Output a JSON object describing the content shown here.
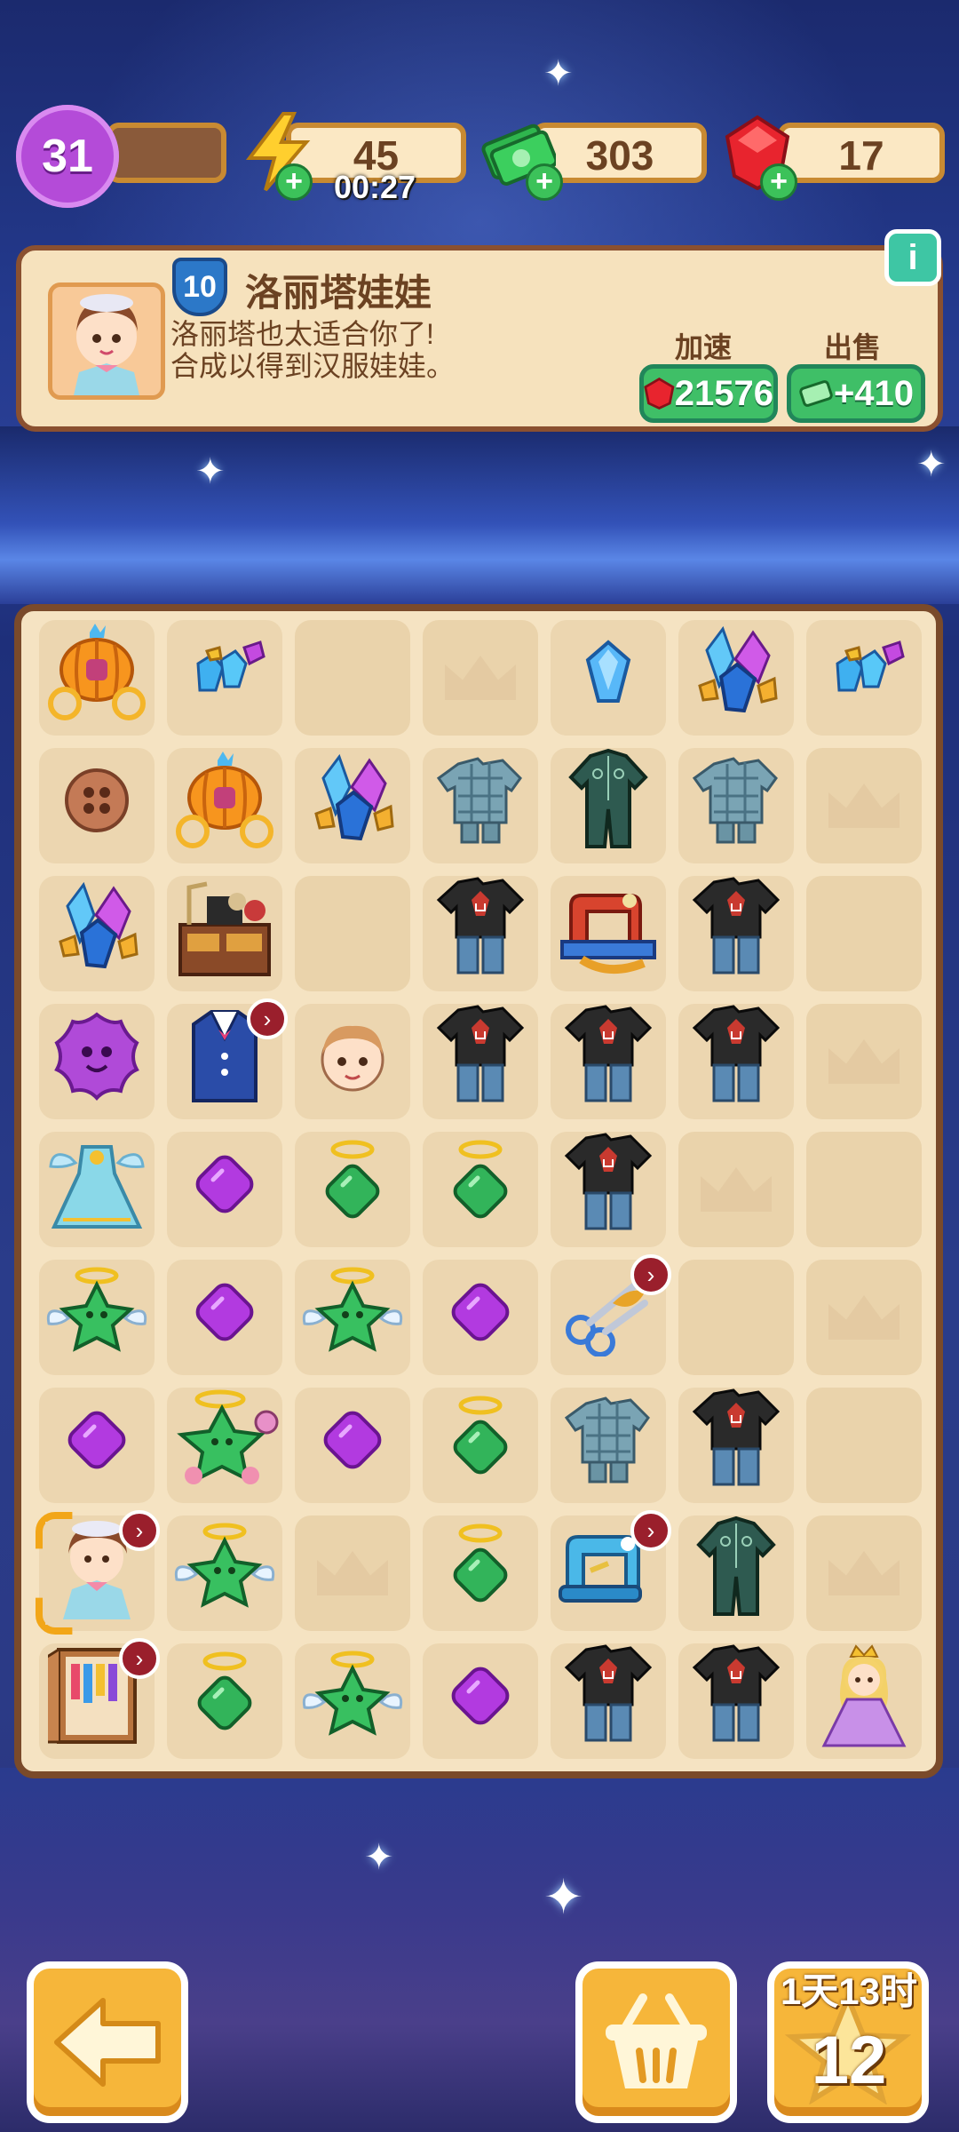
{
  "status": {
    "level": "31",
    "energy": "45",
    "energy_timer": "00:27",
    "cash": "303",
    "gems": "17"
  },
  "info_card": {
    "item_level": "10",
    "item_name": "洛丽塔娃娃",
    "desc_line1": "洛丽塔也太适合你了!",
    "desc_line2": "合成以得到汉服娃娃。",
    "speedup_label": "加速",
    "speedup_cost": "21576",
    "sell_label": "出售",
    "sell_value": "+410"
  },
  "bag": {
    "timer": "1天13时",
    "count": "12"
  },
  "board": {
    "rows": [
      [
        "pumpkin-carriage",
        "gem-cluster-small",
        "empty",
        "crown-empty",
        "crystal-small",
        "gem-cluster-large",
        "gem-cluster-small"
      ],
      [
        "button",
        "pumpkin-carriage",
        "gem-cluster-large",
        "plaid-outfit",
        "green-tracksuit",
        "plaid-outfit",
        "crown-empty"
      ],
      [
        "gem-cluster-large",
        "sewing-workbench",
        "empty",
        "rock-tshirt-outfit",
        "sewing-machine-red",
        "rock-tshirt-outfit",
        "empty"
      ],
      [
        "purple-flower",
        "vest-outfit",
        "doll-head",
        "rock-tshirt-outfit",
        "rock-tshirt-outfit",
        "rock-tshirt-outfit",
        "crown-empty"
      ],
      [
        "fairy-dress",
        "purple-diamond",
        "green-halo-gem",
        "green-halo-gem",
        "rock-tshirt-outfit",
        "crown-empty",
        "empty"
      ],
      [
        "green-angel-star",
        "purple-diamond",
        "green-angel-star",
        "purple-diamond",
        "scissors",
        "empty",
        "crown-empty"
      ],
      [
        "purple-diamond",
        "green-angel-star-big",
        "purple-diamond",
        "green-halo-gem",
        "plaid-outfit",
        "rock-tshirt-outfit",
        "empty"
      ],
      [
        "lolita-doll",
        "green-angel-star",
        "crown-empty",
        "green-halo-gem",
        "sewing-machine-blue",
        "green-tracksuit",
        "crown-empty"
      ],
      [
        "wardrobe",
        "green-halo-gem",
        "green-angel-star",
        "purple-diamond",
        "rock-tshirt-outfit",
        "rock-tshirt-outfit",
        "princess-doll"
      ]
    ]
  },
  "colors": {
    "accent": "#f6b63a",
    "panel": "#f6e2bd",
    "panel_border": "#8a5030",
    "green_button": "#3fbf67"
  }
}
